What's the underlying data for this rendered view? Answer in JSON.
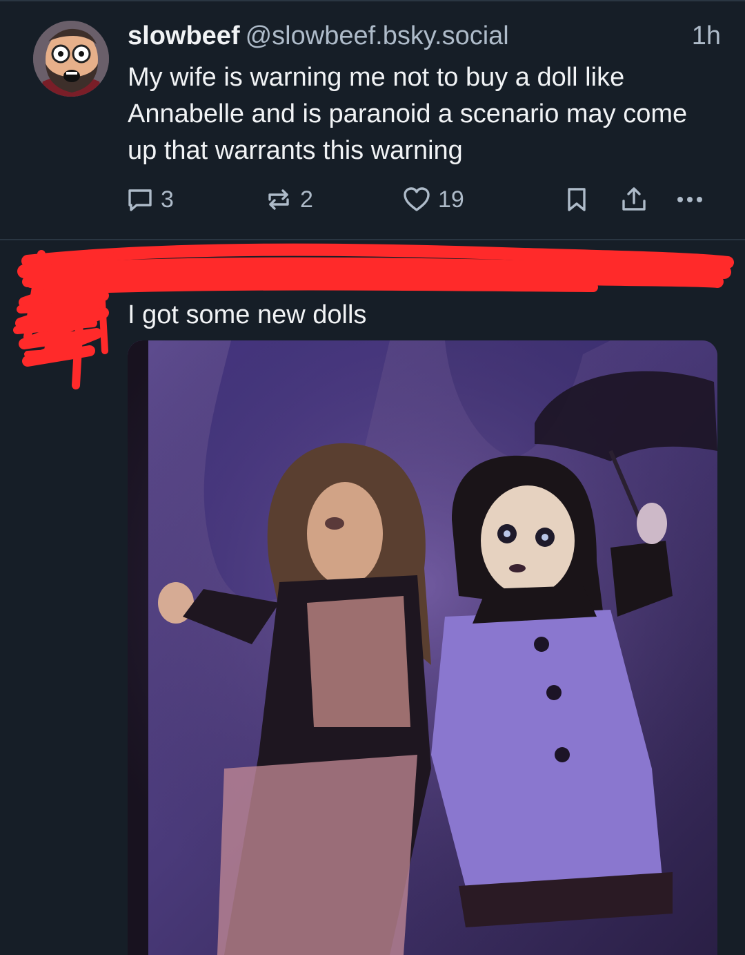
{
  "post1": {
    "display_name": "slowbeef",
    "handle": "@slowbeef.bsky.social",
    "time": "1h",
    "text": "My wife is warning me not to buy a doll like Annabelle and is paranoid a scenario may come up that warrants this warning",
    "replies": "3",
    "reposts": "2",
    "likes": "19"
  },
  "post2": {
    "text": "I got some new dolls"
  },
  "icons": {
    "reply": "speech-bubble-icon",
    "repost": "repost-arrows-icon",
    "like": "heart-icon",
    "bookmark": "bookmark-icon",
    "share": "share-icon",
    "more": "more-dots-icon"
  },
  "colors": {
    "background": "#161e27",
    "text": "#f1f3f5",
    "muted": "#aebbc9",
    "redaction": "#ff2a2a"
  }
}
